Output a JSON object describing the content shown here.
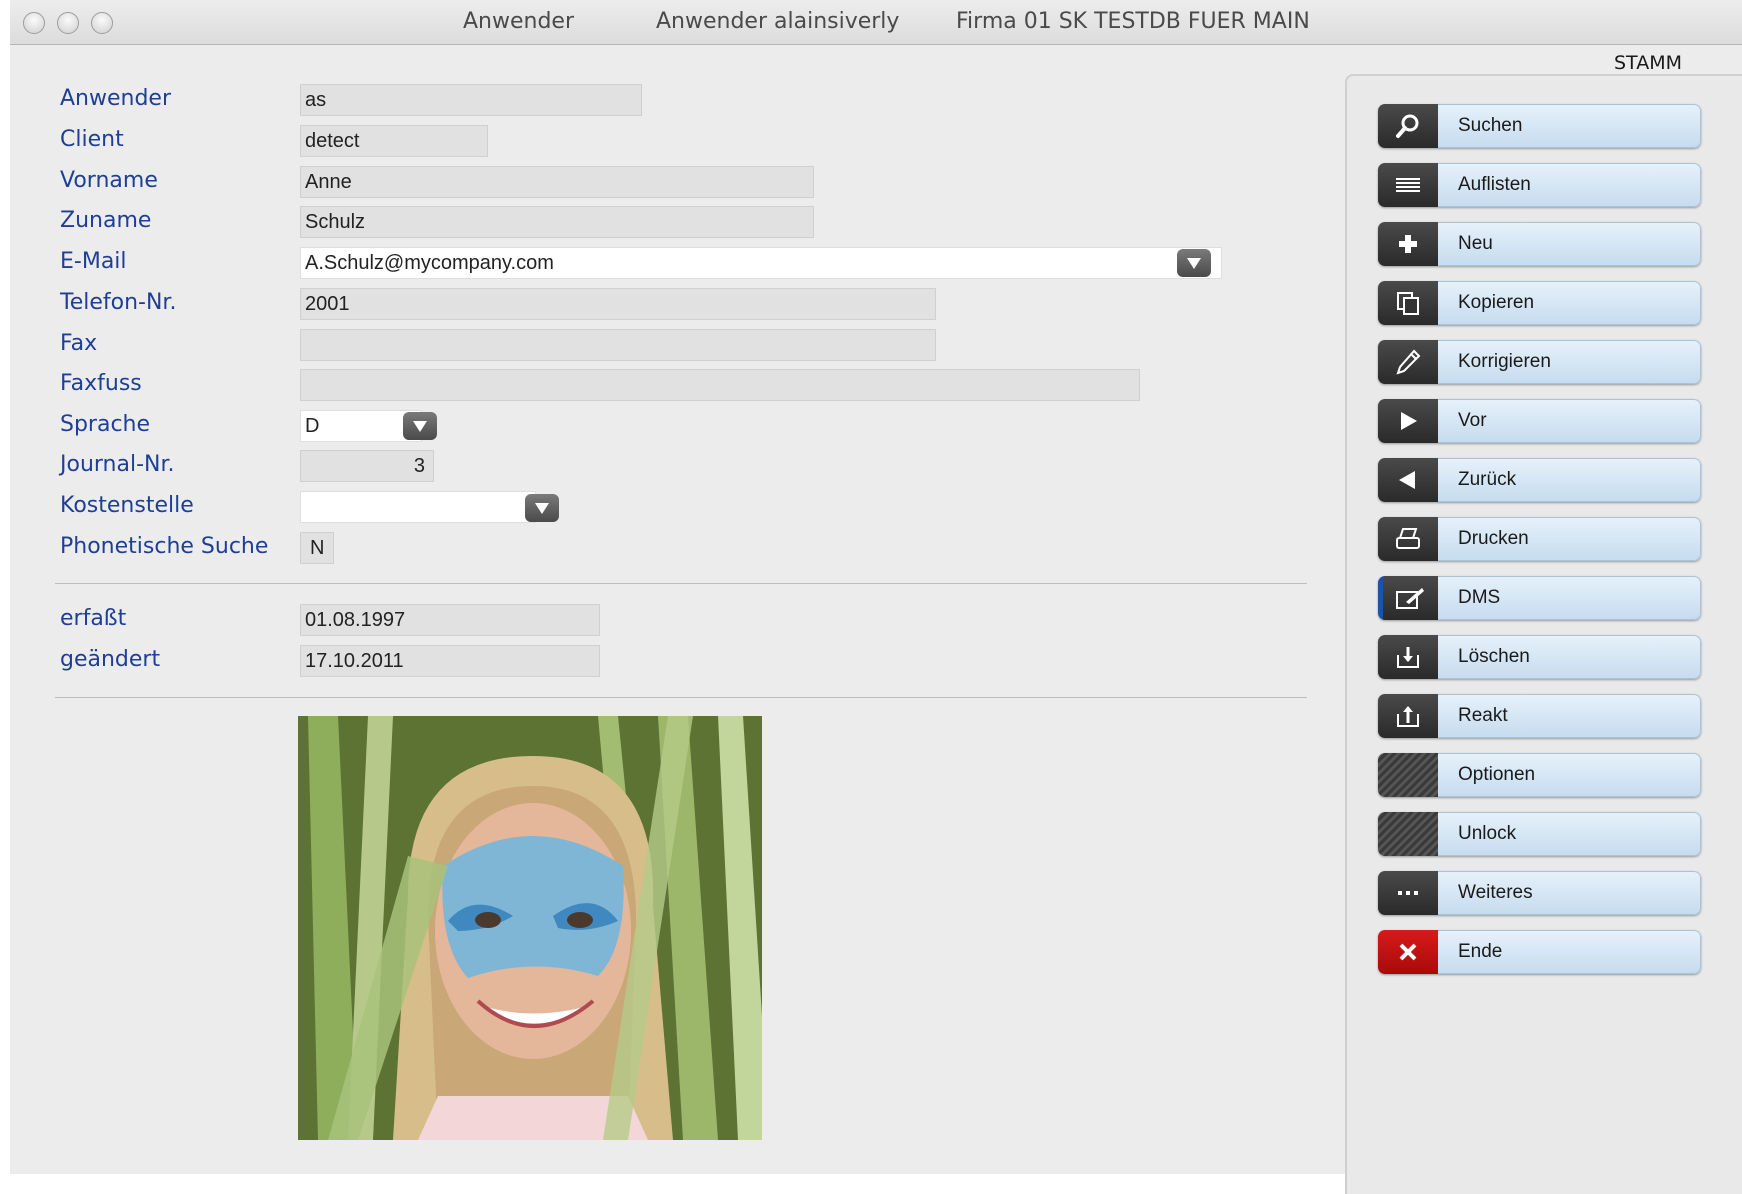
{
  "window": {
    "title_parts": [
      "Anwender",
      "Anwender alainsiverly",
      "Firma 01 SK TESTDB FUER MAIN"
    ]
  },
  "form": {
    "fields": [
      {
        "label": "Anwender",
        "value": "as"
      },
      {
        "label": "Client",
        "value": "detect"
      },
      {
        "label": "Vorname",
        "value": "Anne"
      },
      {
        "label": "Zuname",
        "value": "Schulz"
      },
      {
        "label": "E-Mail",
        "value": "A.Schulz@mycompany.com"
      },
      {
        "label": "Telefon-Nr.",
        "value": "2001"
      },
      {
        "label": "Fax",
        "value": ""
      },
      {
        "label": "Faxfuss",
        "value": ""
      },
      {
        "label": "Sprache",
        "value": "D"
      },
      {
        "label": "Journal-Nr.",
        "value": "3"
      },
      {
        "label": "Kostenstelle",
        "value": ""
      },
      {
        "label": "Phonetische Suche",
        "value": "N"
      }
    ],
    "dates": [
      {
        "label": "erfaßt",
        "value": "01.08.1997"
      },
      {
        "label": "geändert",
        "value": "17.10.2011"
      }
    ]
  },
  "panel": {
    "title": "STAMM",
    "buttons": [
      {
        "label": "Suchen",
        "icon": "search-icon"
      },
      {
        "label": "Auflisten",
        "icon": "list-icon"
      },
      {
        "label": "Neu",
        "icon": "plus-icon"
      },
      {
        "label": "Kopieren",
        "icon": "copy-icon"
      },
      {
        "label": "Korrigieren",
        "icon": "pencil-icon"
      },
      {
        "label": "Vor",
        "icon": "play-forward-icon"
      },
      {
        "label": "Zurück",
        "icon": "play-back-icon"
      },
      {
        "label": "Drucken",
        "icon": "printer-icon"
      },
      {
        "label": "DMS",
        "icon": "document-folder-icon"
      },
      {
        "label": "Löschen",
        "icon": "tray-download-icon"
      },
      {
        "label": "Reakt",
        "icon": "tray-upload-icon"
      },
      {
        "label": "Optionen",
        "icon": "hatched-blank-icon"
      },
      {
        "label": "Unlock",
        "icon": "hatched-blank-icon"
      },
      {
        "label": "Weiteres",
        "icon": "ellipsis-icon"
      },
      {
        "label": "Ende",
        "icon": "close-icon"
      }
    ]
  },
  "colors": {
    "label_blue": "#1f3f97",
    "button_face": "#d6e7f5",
    "icon_dark": "#333333",
    "end_red": "#c01010"
  }
}
